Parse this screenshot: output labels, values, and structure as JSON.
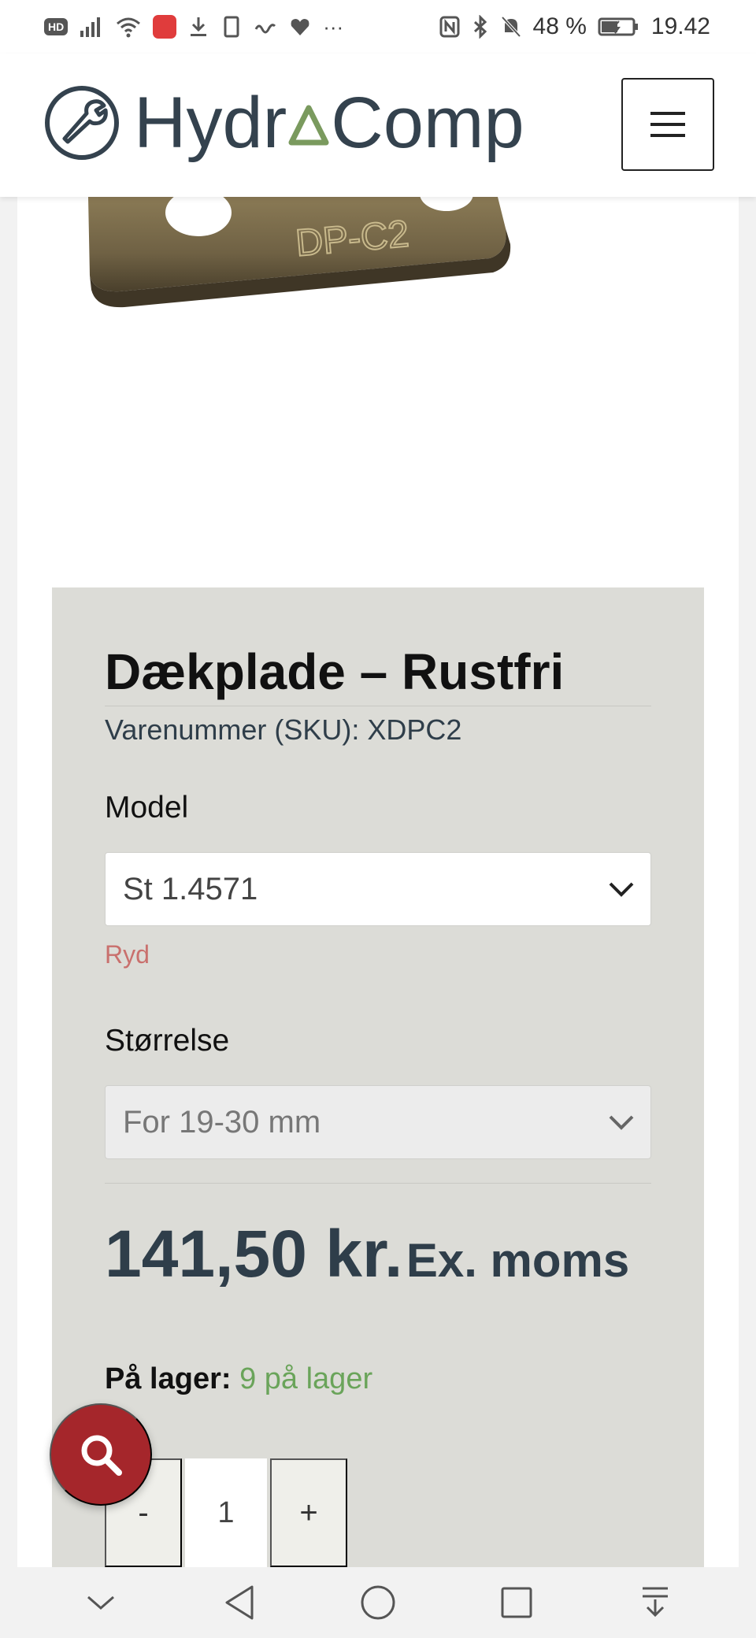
{
  "status_bar": {
    "hd": "HD",
    "more": "···",
    "battery": "48 %",
    "time": "19.42"
  },
  "header": {
    "logo_part1": "Hydr",
    "logo_part2": "Comp",
    "logo_colors": {
      "text": "#34424e",
      "triangle": "#7a9a5e"
    }
  },
  "product_image": {
    "engraving": "DP-C2"
  },
  "product": {
    "title": "Dækplade – Rustfri",
    "sku": "Varenummer (SKU): XDPC2",
    "model_label": "Model",
    "model_value": "St 1.4571",
    "clear_label": "Ryd",
    "size_label": "Størrelse",
    "size_value": "For 19-30 mm",
    "price_amount": "141,50 kr.",
    "price_suffix": "Ex. moms",
    "stock_label": "På lager:",
    "stock_value": "9 på lager",
    "qty_minus": "-",
    "qty_value": "1",
    "qty_plus": "+"
  },
  "colors": {
    "accent_red": "#a5262b",
    "panel_bg": "#dcdcd7",
    "stock_green": "#6aa45a",
    "clear_red": "#c9706d"
  }
}
